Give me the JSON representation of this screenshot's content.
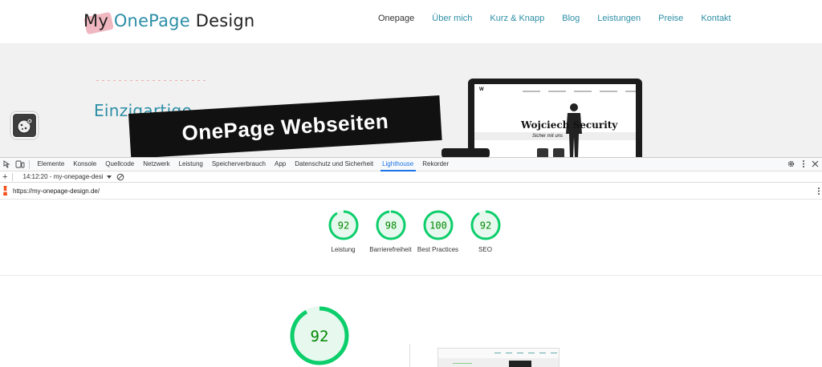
{
  "site": {
    "logo": {
      "part1": "My ",
      "part2": "OnePage",
      "part3": " Design"
    },
    "nav": [
      {
        "label": "Onepage",
        "active": true
      },
      {
        "label": "Über mich",
        "active": false
      },
      {
        "label": "Kurz & Knapp",
        "active": false
      },
      {
        "label": "Blog",
        "active": false
      },
      {
        "label": "Leistungen",
        "active": false
      },
      {
        "label": "Preise",
        "active": false
      },
      {
        "label": "Kontakt",
        "active": false
      }
    ],
    "hero": {
      "kicker": "Einzigartige",
      "headline": "OnePage Webseiten",
      "laptop_title": "Wojciech Security",
      "laptop_sub": "Sicher mit uns"
    }
  },
  "devtools": {
    "tabs": [
      {
        "label": "Elemente",
        "active": false
      },
      {
        "label": "Konsole",
        "active": false
      },
      {
        "label": "Quellcode",
        "active": false
      },
      {
        "label": "Netzwerk",
        "active": false
      },
      {
        "label": "Leistung",
        "active": false
      },
      {
        "label": "Speicherverbrauch",
        "active": false
      },
      {
        "label": "App",
        "active": false
      },
      {
        "label": "Datenschutz und Sicherheit",
        "active": false
      },
      {
        "label": "Lighthouse",
        "active": true
      },
      {
        "label": "Rekorder",
        "active": false
      }
    ],
    "report_select": "14:12:20 - my-onepage-desi ",
    "url": "https://my-onepage-design.de/"
  },
  "lighthouse": {
    "gauges": [
      {
        "score": 92,
        "label": "Leistung"
      },
      {
        "score": 98,
        "label": "Barrierefreiheit"
      },
      {
        "score": 100,
        "label": "Best Practices"
      },
      {
        "score": 92,
        "label": "SEO"
      }
    ],
    "main_score": 92,
    "pass_color": "#0cce6b",
    "pass_fill": "#e7f8ee",
    "pass_text": "#008800"
  },
  "colors": {
    "brand": "#2c8ea6",
    "logo_blob": "#f1b7c0",
    "devtools_active": "#1a73e8"
  }
}
